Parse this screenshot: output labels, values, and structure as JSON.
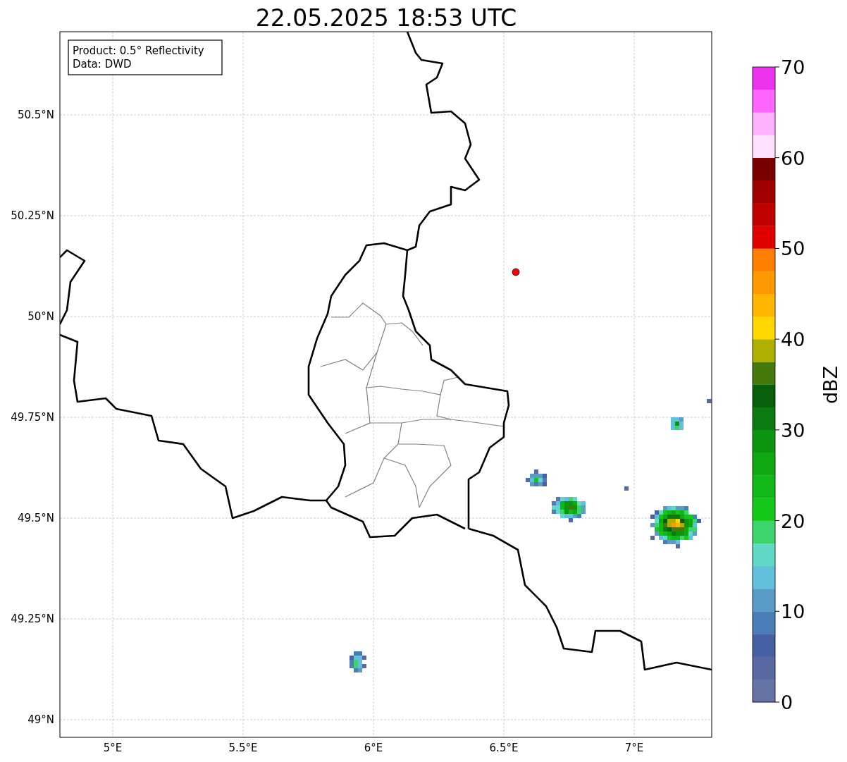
{
  "title": "22.05.2025 18:53 UTC",
  "info_box": [
    "Product: 0.5° Reflectivity",
    "Data: DWD"
  ],
  "map": {
    "lat_labels": [
      "50.5°N",
      "50.25°N",
      "50°N",
      "49.75°N",
      "49.5°N",
      "49.25°N",
      "49°N"
    ],
    "lon_labels": [
      "5°E",
      "5.5°E",
      "6°E",
      "6.5°E",
      "7°E"
    ],
    "marker": {
      "color": "#ff0000"
    }
  },
  "colorbar": {
    "label": "dBZ",
    "ticks": [
      "70",
      "60",
      "50",
      "40",
      "30",
      "20",
      "10",
      "0"
    ],
    "bands": [
      {
        "color": "#6673a5"
      },
      {
        "color": "#5868a0"
      },
      {
        "color": "#4560a3"
      },
      {
        "color": "#4a7db5"
      },
      {
        "color": "#5a9cc8"
      },
      {
        "color": "#63c0dc"
      },
      {
        "color": "#62d8c8"
      },
      {
        "color": "#3cd46c"
      },
      {
        "color": "#14c81a"
      },
      {
        "color": "#10b818"
      },
      {
        "color": "#0fa813"
      },
      {
        "color": "#0d9510"
      },
      {
        "color": "#0b7a10"
      },
      {
        "color": "#075f0b"
      },
      {
        "color": "#457a0a"
      },
      {
        "color": "#b0b000"
      },
      {
        "color": "#ffd700"
      },
      {
        "color": "#ffb600"
      },
      {
        "color": "#ff9900"
      },
      {
        "color": "#ff7f00"
      },
      {
        "color": "#e00000"
      },
      {
        "color": "#c00000"
      },
      {
        "color": "#a00000"
      },
      {
        "color": "#7a0000"
      },
      {
        "color": "#ffe0ff"
      },
      {
        "color": "#ffb3ff"
      },
      {
        "color": "#ff66ff"
      },
      {
        "color": "#ee33ee"
      }
    ]
  }
}
